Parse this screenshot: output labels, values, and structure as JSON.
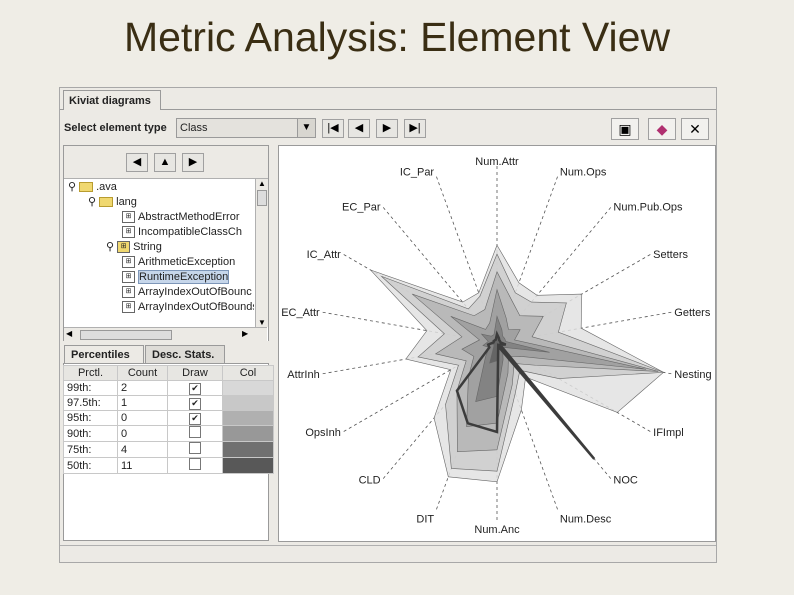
{
  "slide": {
    "title": "Metric Analysis: Element View"
  },
  "app": {
    "tab_title": "Kiviat diagrams",
    "toolbar": {
      "label": "Select element type",
      "element_type": "Class"
    },
    "tree": {
      "root": ".ava",
      "package": "lang",
      "items": [
        "AbstractMethodError",
        "IncompatibleClassCh",
        "String",
        "ArithmeticException",
        "RuntimeException",
        "ArrayIndexOutOfBounc",
        "ArrayIndexOutOfBoundsExc"
      ],
      "selected": "RuntimeException"
    },
    "tabs": [
      "Percentiles",
      "Desc. Stats."
    ],
    "table": {
      "headers": [
        "Prctl.",
        "Count",
        "Draw",
        "Col"
      ],
      "rows": [
        {
          "prctl": "99th:",
          "count": "2",
          "draw": true,
          "color": "#d8d8d8"
        },
        {
          "prctl": "97.5th:",
          "count": "1",
          "draw": true,
          "color": "#c8c8c8"
        },
        {
          "prctl": "95th:",
          "count": "0",
          "draw": true,
          "color": "#b0b0b0"
        },
        {
          "prctl": "90th:",
          "count": "0",
          "draw": false,
          "color": "#989898"
        },
        {
          "prctl": "75th:",
          "count": "4",
          "draw": false,
          "color": "#707070"
        },
        {
          "prctl": "50th:",
          "count": "11",
          "draw": false,
          "color": "#585858"
        }
      ]
    }
  },
  "chart_data": {
    "type": "radar",
    "axes": [
      "Num.Attr",
      "Num.Ops",
      "Num.Pub.Ops",
      "Setters",
      "Getters",
      "Nesting",
      "IFImpl",
      "NOC",
      "Num.Desc",
      "Num.Anc",
      "DIT",
      "CLD",
      "OpsInh",
      "AttrInh",
      "EC_Attr",
      "IC_Attr",
      "EC_Par",
      "IC_Par"
    ],
    "series": [
      {
        "values": [
          0.55,
          0.36,
          0.35,
          0.55,
          0.48,
          0.95,
          0.78,
          0.25,
          0.4,
          0.78,
          0.8,
          0.55,
          0.3,
          0.52,
          0.4,
          0.82,
          0.3,
          0.3
        ],
        "color": "#e2e2e2"
      },
      {
        "values": [
          0.5,
          0.3,
          0.3,
          0.45,
          0.35,
          0.95,
          0.4,
          0.2,
          0.3,
          0.72,
          0.75,
          0.45,
          0.25,
          0.45,
          0.3,
          0.75,
          0.25,
          0.28
        ],
        "color": "#cdcdcd"
      },
      {
        "values": [
          0.4,
          0.25,
          0.2,
          0.3,
          0.2,
          0.92,
          0.25,
          0.15,
          0.25,
          0.6,
          0.65,
          0.35,
          0.2,
          0.35,
          0.2,
          0.55,
          0.2,
          0.2
        ],
        "color": "#b5b5b5"
      },
      {
        "values": [
          0.3,
          0.15,
          0.1,
          0.15,
          0.1,
          0.85,
          0.15,
          0.1,
          0.18,
          0.45,
          0.5,
          0.25,
          0.15,
          0.2,
          0.1,
          0.3,
          0.1,
          0.12
        ],
        "color": "#9c9c9c"
      },
      {
        "values": [
          0.15,
          0.08,
          0.05,
          0.05,
          0.05,
          0.3,
          0.05,
          0.05,
          0.1,
          0.3,
          0.35,
          0.1,
          0.05,
          0.08,
          0.05,
          0.1,
          0.05,
          0.05
        ],
        "color": "#7e7e7e"
      },
      {
        "values": [
          0.05,
          0.03,
          0.02,
          0.02,
          0.02,
          0.05,
          0.02,
          0.02,
          0.03,
          0.1,
          0.12,
          0.03,
          0.02,
          0.03,
          0.02,
          0.03,
          0.02,
          0.02
        ],
        "color": "#606060"
      }
    ],
    "highlight": {
      "name": "RuntimeException",
      "values": [
        0.05,
        0.03,
        0.02,
        0.02,
        0.02,
        0.05,
        0.02,
        0.85,
        0.02,
        0.5,
        0.48,
        0.35,
        0.05,
        0.05,
        0.02,
        0.02,
        0.02,
        0.02
      ],
      "color": "#3c3c3c"
    }
  }
}
